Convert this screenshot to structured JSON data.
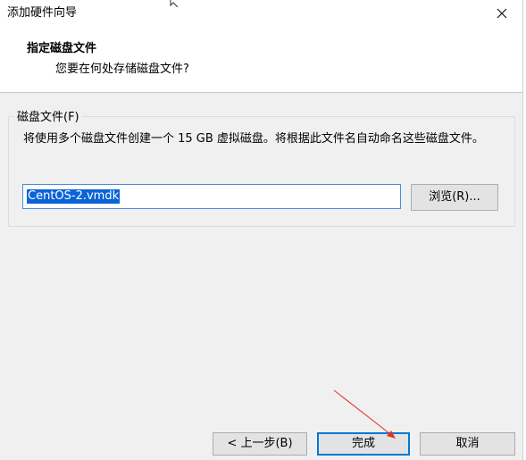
{
  "window": {
    "title": "添加硬件向导"
  },
  "header": {
    "title": "指定磁盘文件",
    "subtitle": "您要在何处存储磁盘文件?"
  },
  "disk_file_group": {
    "legend": "磁盘文件(F)",
    "description": "将使用多个磁盘文件创建一个 15 GB 虚拟磁盘。将根据此文件名自动命名这些磁盘文件。",
    "file_name_value": "CentOS-2.vmdk",
    "browse_label": "浏览(R)..."
  },
  "footer": {
    "back_label": "< 上一步(B)",
    "finish_label": "完成",
    "cancel_label": "取消"
  },
  "colors": {
    "selection": "#0a64d6",
    "focus_border": "#0078d7",
    "annotation_arrow": "#e0302a"
  }
}
